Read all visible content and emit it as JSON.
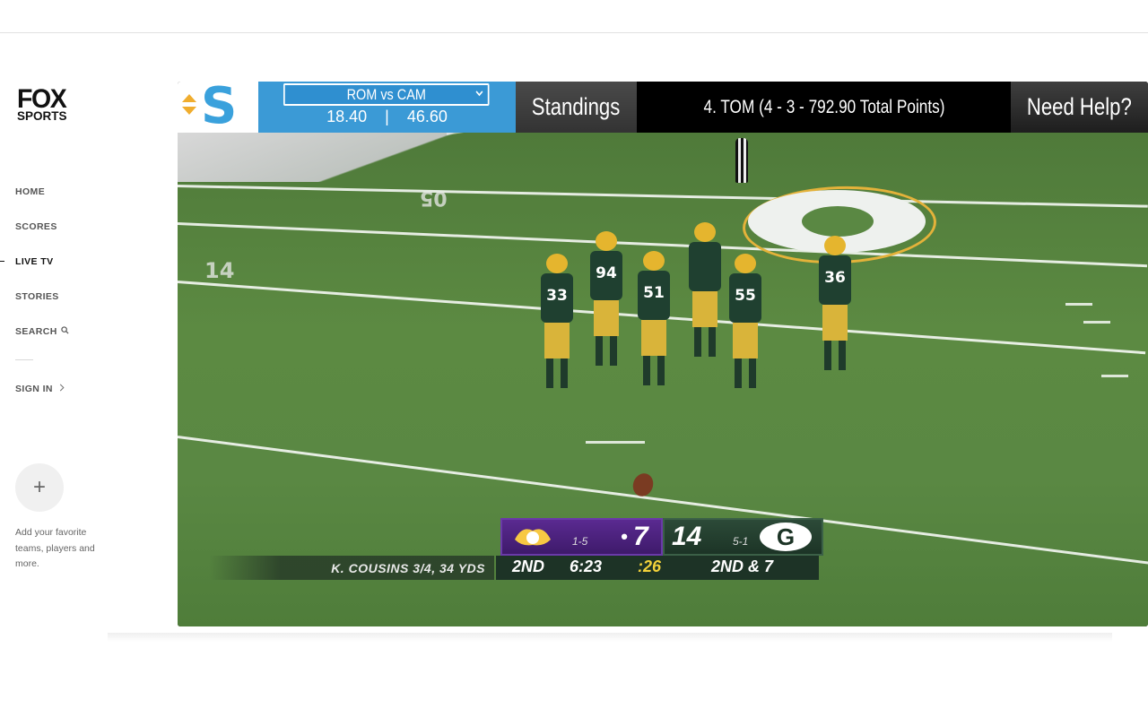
{
  "brand": {
    "line1": "FOX",
    "line2": "SPORTS"
  },
  "nav": {
    "home": "HOME",
    "scores": "SCORES",
    "live_tv": "LIVE TV",
    "stories": "STORIES",
    "search": "SEARCH",
    "sign_in": "SIGN IN"
  },
  "favorites": {
    "plus": "+",
    "text": "Add your favorite teams, players and more."
  },
  "extension": {
    "logo_letter": "S",
    "matchup": "ROM vs CAM",
    "score_left": "18.40",
    "divider": "|",
    "score_right": "46.60",
    "standings_label": "Standings",
    "team_status": "4. TOM (4 - 3 - 792.90 Total Points)",
    "help_label": "Need Help?"
  },
  "field": {
    "yard_left": "05",
    "yard_left2": "14",
    "jerseys": [
      "94",
      "51",
      "55",
      "36",
      "33"
    ]
  },
  "scorebug": {
    "visitor_record": "1-5",
    "visitor_score": "7",
    "visitor_dot": "•",
    "home_score": "14",
    "home_record": "5-1",
    "home_logo": "G",
    "stat_line": "K. COUSINS 3/4, 34 YDS",
    "quarter": "2ND",
    "clock": "6:23",
    "play_clock": ":26",
    "down_distance": "2ND & 7"
  },
  "colors": {
    "accent_blue": "#3b9ad6",
    "vikings_purple": "#4f2683",
    "packers_green": "#203731",
    "packers_gold": "#ffb612"
  }
}
